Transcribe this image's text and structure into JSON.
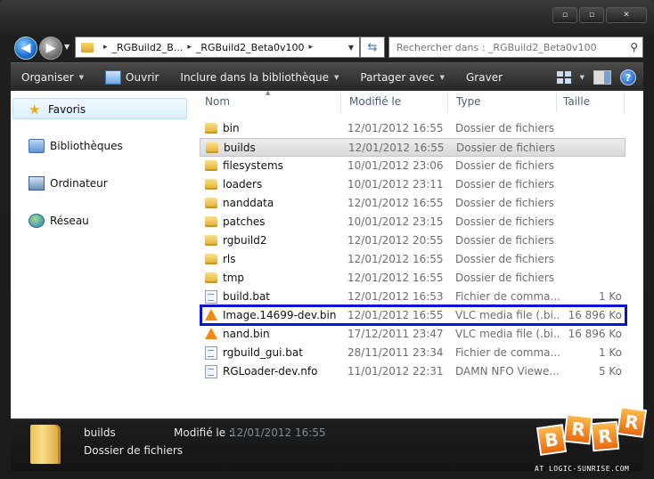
{
  "window": {
    "controls": [
      "▫",
      "▫",
      "✕"
    ]
  },
  "nav": {
    "back_icon": "back-arrow-icon",
    "forward_icon": "forward-arrow-icon",
    "breadcrumb": [
      "_RGBuild2_B...",
      "_RGBuild2_Beta0v100"
    ],
    "search_placeholder": "Rechercher dans : _RGBuild2_Beta0v100"
  },
  "toolbar": {
    "organiser": "Organiser",
    "ouvrir": "Ouvrir",
    "inclure": "Inclure dans la bibliothèque",
    "partager": "Partager avec",
    "graver": "Graver",
    "help": "?"
  },
  "sidebar": {
    "items": [
      {
        "label": "Favoris",
        "icon": "star-icon"
      },
      {
        "label": "Bibliothèques",
        "icon": "library-icon"
      },
      {
        "label": "Ordinateur",
        "icon": "computer-icon"
      },
      {
        "label": "Réseau",
        "icon": "network-icon"
      }
    ]
  },
  "columns": {
    "name": "Nom",
    "modified": "Modifié le",
    "type": "Type",
    "size": "Taille"
  },
  "files": [
    {
      "name": "bin",
      "modified": "12/01/2012 16:55",
      "type": "Dossier de fichiers",
      "size": "",
      "icon": "folder-icon"
    },
    {
      "name": "builds",
      "modified": "12/01/2012 16:55",
      "type": "Dossier de fichiers",
      "size": "",
      "icon": "folder-icon",
      "selected": true
    },
    {
      "name": "filesystems",
      "modified": "10/01/2012 23:06",
      "type": "Dossier de fichiers",
      "size": "",
      "icon": "folder-icon"
    },
    {
      "name": "loaders",
      "modified": "10/01/2012 23:11",
      "type": "Dossier de fichiers",
      "size": "",
      "icon": "folder-icon"
    },
    {
      "name": "nanddata",
      "modified": "12/01/2012 16:55",
      "type": "Dossier de fichiers",
      "size": "",
      "icon": "folder-icon"
    },
    {
      "name": "patches",
      "modified": "10/01/2012 23:15",
      "type": "Dossier de fichiers",
      "size": "",
      "icon": "folder-icon"
    },
    {
      "name": "rgbuild2",
      "modified": "12/01/2012 20:55",
      "type": "Dossier de fichiers",
      "size": "",
      "icon": "folder-icon"
    },
    {
      "name": "rls",
      "modified": "12/01/2012 16:55",
      "type": "Dossier de fichiers",
      "size": "",
      "icon": "folder-icon"
    },
    {
      "name": "tmp",
      "modified": "12/01/2012 16:55",
      "type": "Dossier de fichiers",
      "size": "",
      "icon": "folder-icon"
    },
    {
      "name": "build.bat",
      "modified": "12/01/2012 16:53",
      "type": "Fichier de comma...",
      "size": "1 Ko",
      "icon": "batch-file-icon"
    },
    {
      "name": "Image.14699-dev.bin",
      "modified": "12/01/2012 16:55",
      "type": "VLC media file (.bi...",
      "size": "16 896 Ko",
      "icon": "vlc-cone-icon",
      "highlighted": true
    },
    {
      "name": "nand.bin",
      "modified": "17/12/2011 23:47",
      "type": "VLC media file (.bi...",
      "size": "16 896 Ko",
      "icon": "vlc-cone-icon"
    },
    {
      "name": "rgbuild_gui.bat",
      "modified": "28/11/2011 23:34",
      "type": "Fichier de comma...",
      "size": "1 Ko",
      "icon": "batch-file-icon"
    },
    {
      "name": "RGLoader-dev.nfo",
      "modified": "11/01/2012 22:31",
      "type": "DAMN NFO Viewe...",
      "size": "5 Ko",
      "icon": "nfo-file-icon"
    }
  ],
  "details": {
    "name": "builds",
    "type": "Dossier de fichiers",
    "modified_label": "Modifié le :",
    "modified_value": "12/01/2012 16:55"
  },
  "watermark": {
    "letters": [
      "B",
      "R",
      "R",
      "R"
    ],
    "tagline": "AT LOGIC-SUNRISE.COM"
  },
  "colors": {
    "highlight_box": "#0a16cc",
    "selected_row": "#dadada",
    "folder": "#e1ad2e",
    "vlc": "#f08a10"
  }
}
